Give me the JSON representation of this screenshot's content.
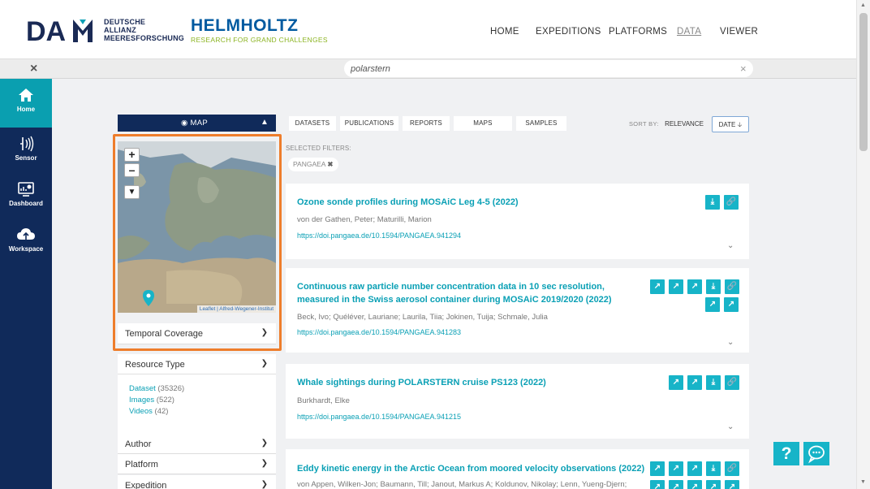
{
  "header": {
    "dam_text": [
      "DEUTSCHE",
      "ALLIANZ",
      "MEERESFORSCHUNG"
    ],
    "helmholtz_title": "HELMHOLTZ",
    "helmholtz_sub": "RESEARCH FOR GRAND CHALLENGES",
    "nav": [
      "HOME",
      "EXPEDITIONS",
      "PLATFORMS",
      "DATA",
      "VIEWER"
    ],
    "active_nav": "DATA"
  },
  "search": {
    "close": "×",
    "value": "polarstern",
    "clear": "×"
  },
  "sidebar": {
    "items": [
      {
        "label": "Home",
        "icon": "home-icon"
      },
      {
        "label": "Sensor",
        "icon": "sensor-icon"
      },
      {
        "label": "Dashboard",
        "icon": "dashboard-icon"
      },
      {
        "label": "Workspace",
        "icon": "cloud-icon"
      }
    ]
  },
  "filters": {
    "map_label": "MAP",
    "map_attribution": "Leaflet | Alfred-Wegener-Institut",
    "temporal": "Temporal Coverage",
    "resource_type": "Resource Type",
    "resource_items": [
      {
        "label": "Dataset",
        "count": "(35326)"
      },
      {
        "label": "Images",
        "count": "(522)"
      },
      {
        "label": "Videos",
        "count": "(42)"
      }
    ],
    "author": "Author",
    "platform": "Platform",
    "expedition": "Expedition"
  },
  "tabs": [
    "DATASETS",
    "PUBLICATIONS",
    "REPORTS",
    "MAPS",
    "SAMPLES"
  ],
  "sort": {
    "label": "SORT BY:",
    "relevance": "RELEVANCE",
    "date": "DATE"
  },
  "selected": {
    "label": "SELECTED FILTERS:",
    "chip": "PANGAEA"
  },
  "results": [
    {
      "title": "Ozone sonde profiles during MOSAiC Leg 4-5 (2022)",
      "authors": "von der Gathen, Peter; Maturilli, Marion",
      "doi": "https://doi.pangaea.de/10.1594/PANGAEA.941294"
    },
    {
      "title_line1": "Continuous raw particle number concentration data in 10 sec resolution,",
      "title_line2": "measured in the Swiss aerosol container during MOSAiC 2019/2020 (2022)",
      "authors": "Beck, Ivo; Quéléver, Lauriane; Laurila, Tiia; Jokinen, Tuija; Schmale, Julia",
      "doi": "https://doi.pangaea.de/10.1594/PANGAEA.941283"
    },
    {
      "title": "Whale sightings during POLARSTERN cruise PS123 (2022)",
      "authors": "Burkhardt, Elke",
      "doi": "https://doi.pangaea.de/10.1594/PANGAEA.941215"
    },
    {
      "title": "Eddy kinetic energy in the Arctic Ocean from moored velocity observations (2022)",
      "authors": "von Appen, Wilken-Jon; Baumann, Till; Janout, Markus A; Koldunov, Nikolay; Lenn, Yueng-Djern;"
    }
  ],
  "help": "?",
  "colors": {
    "navy": "#102a5a",
    "teal": "#17b4c8",
    "accent": "#ee7d2b"
  }
}
